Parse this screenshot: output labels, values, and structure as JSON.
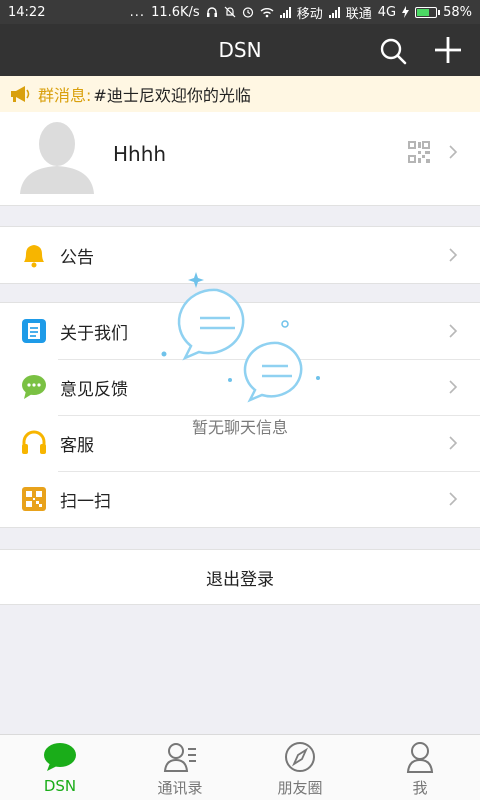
{
  "status_bar": {
    "time": "14:22",
    "dots": "...",
    "speed": "11.6K/s",
    "carrier1": "移动",
    "carrier2": "联通",
    "network": "4G",
    "battery": "58%",
    "battery_level": 0.58
  },
  "header": {
    "title": "DSN",
    "search_icon": "search-icon",
    "add_icon": "plus-icon"
  },
  "notice": {
    "label": "群消息:",
    "text": "#迪士尼欢迎你的光临"
  },
  "profile": {
    "name": "Hhhh"
  },
  "menu": {
    "announcement": "公告",
    "about": "关于我们",
    "feedback": "意见反馈",
    "service": "客服",
    "scan": "扫一扫"
  },
  "logout_label": "退出登录",
  "empty_state": {
    "text": "暂无聊天信息"
  },
  "bottom_nav": {
    "items": [
      {
        "label": "DSN",
        "icon": "chat-bubble-icon",
        "active": true
      },
      {
        "label": "通讯录",
        "icon": "contacts-icon",
        "active": false
      },
      {
        "label": "朋友圈",
        "icon": "compass-icon",
        "active": false
      },
      {
        "label": "我",
        "icon": "person-icon",
        "active": false
      }
    ]
  },
  "colors": {
    "header_bg": "#333333",
    "accent_green": "#1aad19",
    "notice_bg": "#fff7e3",
    "notice_label": "#d9a00d"
  }
}
